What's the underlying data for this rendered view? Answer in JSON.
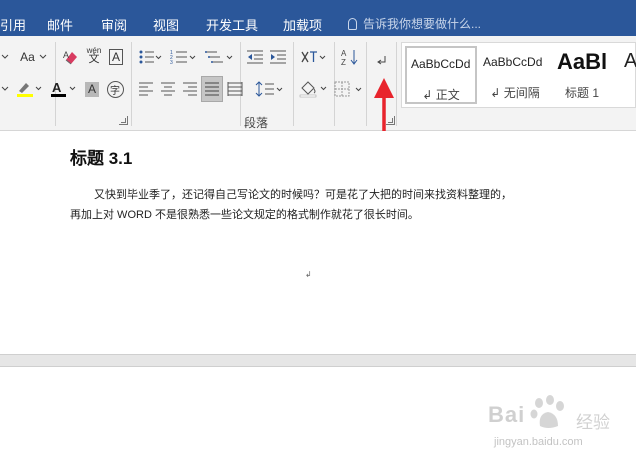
{
  "tabs": [
    {
      "label": "引用"
    },
    {
      "label": "邮件"
    },
    {
      "label": "审阅"
    },
    {
      "label": "视图"
    },
    {
      "label": "开发工具"
    },
    {
      "label": "加载项"
    }
  ],
  "tell_me": {
    "placeholder": "告诉我你想要做什么..."
  },
  "ribbon": {
    "font_size_btn": "Aa",
    "phonetic_top": "wén",
    "phonetic_bottom": "文",
    "border_letter": "A",
    "char_shading": "A",
    "enclose_char": "字",
    "paragraph_group_label": "段落"
  },
  "styles": [
    {
      "sample": "AaBbCcDd",
      "name": "正文"
    },
    {
      "sample": "AaBbCcDd",
      "name": "无间隔"
    },
    {
      "sample": "AaBl",
      "name": "标题 1"
    },
    {
      "sample": "A",
      "name": ""
    }
  ],
  "document": {
    "heading": "标题 3.1",
    "line1": "又快到毕业季了，还记得自己写论文的时候吗？可是花了大把的时间来找资料整理的，",
    "line2": "再加上对 WORD 不是很熟悉一些论文规定的格式制作就花了很长时间。",
    "paragraph_mark": "↲"
  },
  "watermark": {
    "brand_left": "Bai",
    "brand_right": "经验",
    "url": "jingyan.baidu.com"
  },
  "colors": {
    "tabbar": "#2b579a",
    "annotation_arrow": "#e8242c",
    "highlight": "#ffff00",
    "font_color": "#000000"
  }
}
